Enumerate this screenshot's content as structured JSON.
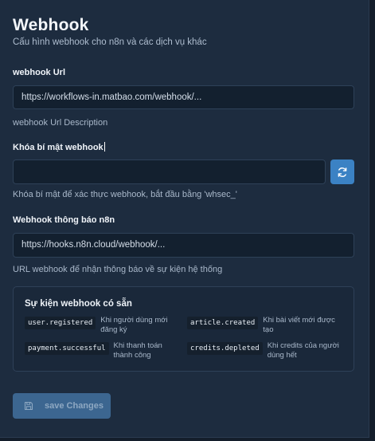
{
  "header": {
    "title": "Webhook",
    "subtitle": "Cấu hình webhook cho n8n và các dịch vụ khác"
  },
  "webhook_url": {
    "label": "webhook Url",
    "value": "https://workflows-in.matbao.com/webhook/...",
    "description": "webhook Url Description"
  },
  "secret": {
    "label": "Khóa bí mật webhook",
    "value": "",
    "description": "Khóa bí mật để xác thực webhook, bắt đầu bằng 'whsec_'",
    "refresh_icon": "refresh-icon"
  },
  "notify_url": {
    "label": "Webhook thông báo n8n",
    "value": "https://hooks.n8n.cloud/webhook/...",
    "description": "URL webhook để nhận thông báo về sự kiện hệ thống"
  },
  "events": {
    "title": "Sự kiện webhook có sẵn",
    "items": [
      {
        "code": "user.registered",
        "desc": "Khi người dùng mới đăng ký"
      },
      {
        "code": "article.created",
        "desc": "Khi bài viết mới được tạo"
      },
      {
        "code": "payment.successful",
        "desc": "Khi thanh toán thành công"
      },
      {
        "code": "credits.depleted",
        "desc": "Khi credits của người dùng hết"
      }
    ]
  },
  "actions": {
    "save_label": "save Changes",
    "save_icon": "floppy-disk-icon"
  },
  "colors": {
    "panel_bg": "#1d2c3f",
    "input_bg": "#13202f",
    "accent": "#3b82c4",
    "save_button_bg": "#3c6690"
  }
}
